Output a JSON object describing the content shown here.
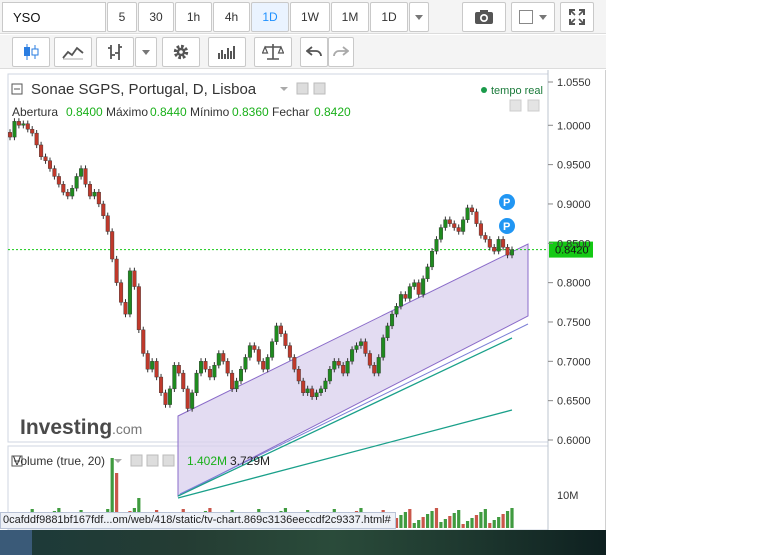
{
  "toolbar": {
    "symbol": "YSO",
    "intervals": [
      "5",
      "30",
      "1h",
      "4h",
      "1D",
      "1W",
      "1M",
      "1D"
    ],
    "active_interval": "1D"
  },
  "icons": {
    "camera": "camera-icon",
    "color_swatch": "color-swatch-icon",
    "fullscreen": "fullscreen-icon",
    "candles": "candlestick-icon",
    "indicators": "indicators-icon",
    "compare": "compare-icon",
    "settings": "gear-icon",
    "bars": "bars-icon",
    "scale": "balance-icon",
    "undo": "undo-icon",
    "redo": "redo-icon"
  },
  "chart": {
    "title": "Sonae SGPS, Portugal, D, Lisboa",
    "realtime_label": "tempo real",
    "ohlc": [
      {
        "label": "Abertura",
        "value": "0.8400"
      },
      {
        "label": "Máximo",
        "value": "0.8440"
      },
      {
        "label": "Mínimo",
        "value": "0.8360"
      },
      {
        "label": "Fechar",
        "value": "0.8420"
      }
    ],
    "last_price": "0.8420",
    "price_axis": [
      "1.0550",
      "1.0000",
      "0.9500",
      "0.9000",
      "0.8500",
      "0.8000",
      "0.7500",
      "0.7000",
      "0.6500",
      "0.6000"
    ],
    "watermark_brand": "Investing",
    "watermark_suffix": ".com",
    "volume": {
      "label": "Volume (true, 20)",
      "value1": "1.402M",
      "value2": "3.729M",
      "axis_label": "10M"
    },
    "marker_label": "P",
    "colors": {
      "up": "#1f8a1f",
      "down": "#c0392b",
      "channel": "#8a6bc9",
      "channel_fill": "#d9d0ee",
      "trend": "#1aa08a",
      "last_price": "#14c914",
      "marker": "#2196f3"
    }
  },
  "chart_data": {
    "type": "candlestick",
    "title": "Sonae SGPS, Portugal, D, Lisboa",
    "ylim": [
      0.6,
      1.06
    ],
    "close": [
      0.985,
      1.005,
      1.0,
      1.002,
      0.995,
      0.99,
      0.975,
      0.96,
      0.955,
      0.945,
      0.935,
      0.925,
      0.915,
      0.91,
      0.92,
      0.935,
      0.945,
      0.925,
      0.91,
      0.915,
      0.9,
      0.885,
      0.865,
      0.83,
      0.8,
      0.775,
      0.76,
      0.815,
      0.795,
      0.74,
      0.71,
      0.69,
      0.7,
      0.68,
      0.66,
      0.645,
      0.665,
      0.695,
      0.685,
      0.665,
      0.64,
      0.66,
      0.685,
      0.7,
      0.69,
      0.68,
      0.695,
      0.71,
      0.7,
      0.685,
      0.665,
      0.675,
      0.69,
      0.705,
      0.72,
      0.715,
      0.7,
      0.69,
      0.705,
      0.725,
      0.745,
      0.735,
      0.72,
      0.705,
      0.69,
      0.675,
      0.66,
      0.665,
      0.655,
      0.66,
      0.665,
      0.675,
      0.69,
      0.7,
      0.695,
      0.685,
      0.7,
      0.715,
      0.72,
      0.725,
      0.71,
      0.695,
      0.685,
      0.705,
      0.73,
      0.745,
      0.76,
      0.77,
      0.785,
      0.78,
      0.795,
      0.8,
      0.785,
      0.805,
      0.82,
      0.84,
      0.855,
      0.87,
      0.88,
      0.875,
      0.87,
      0.865,
      0.88,
      0.895,
      0.89,
      0.875,
      0.86,
      0.855,
      0.845,
      0.84,
      0.855,
      0.845,
      0.835,
      0.842
    ],
    "last_price": 0.842,
    "price_ticks": [
      1.055,
      1.0,
      0.95,
      0.9,
      0.85,
      0.8,
      0.75,
      0.7,
      0.65,
      0.6
    ],
    "volume_label": "Volume (true, 20)"
  }
}
